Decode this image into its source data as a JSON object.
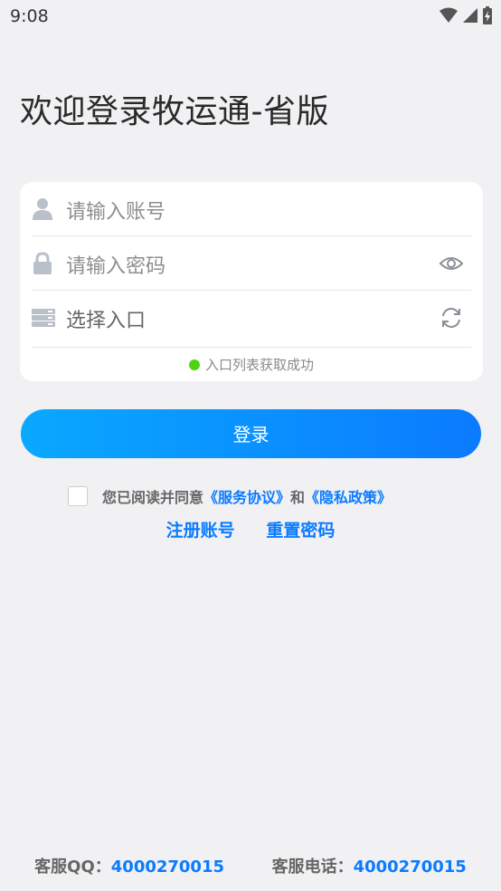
{
  "status_bar": {
    "time": "9:08"
  },
  "title": "欢迎登录牧运通-省版",
  "form": {
    "account_placeholder": "请输入账号",
    "password_placeholder": "请输入密码",
    "entry_placeholder": "选择入口",
    "entry_status": "入口列表获取成功"
  },
  "login_button": "登录",
  "agreement": {
    "prefix": "您已阅读并同意 ",
    "service": "《服务协议》",
    "and": "和 ",
    "privacy": "《隐私政策》"
  },
  "links": {
    "register": "注册账号",
    "reset": "重置密码"
  },
  "footer": {
    "qq_label": "客服QQ：",
    "qq_number": "4000270015",
    "phone_label": "客服电话：",
    "phone_number": "4000270015"
  },
  "colors": {
    "accent": "#0b7bff",
    "success": "#4dd30f",
    "background": "#f1f1f3"
  }
}
